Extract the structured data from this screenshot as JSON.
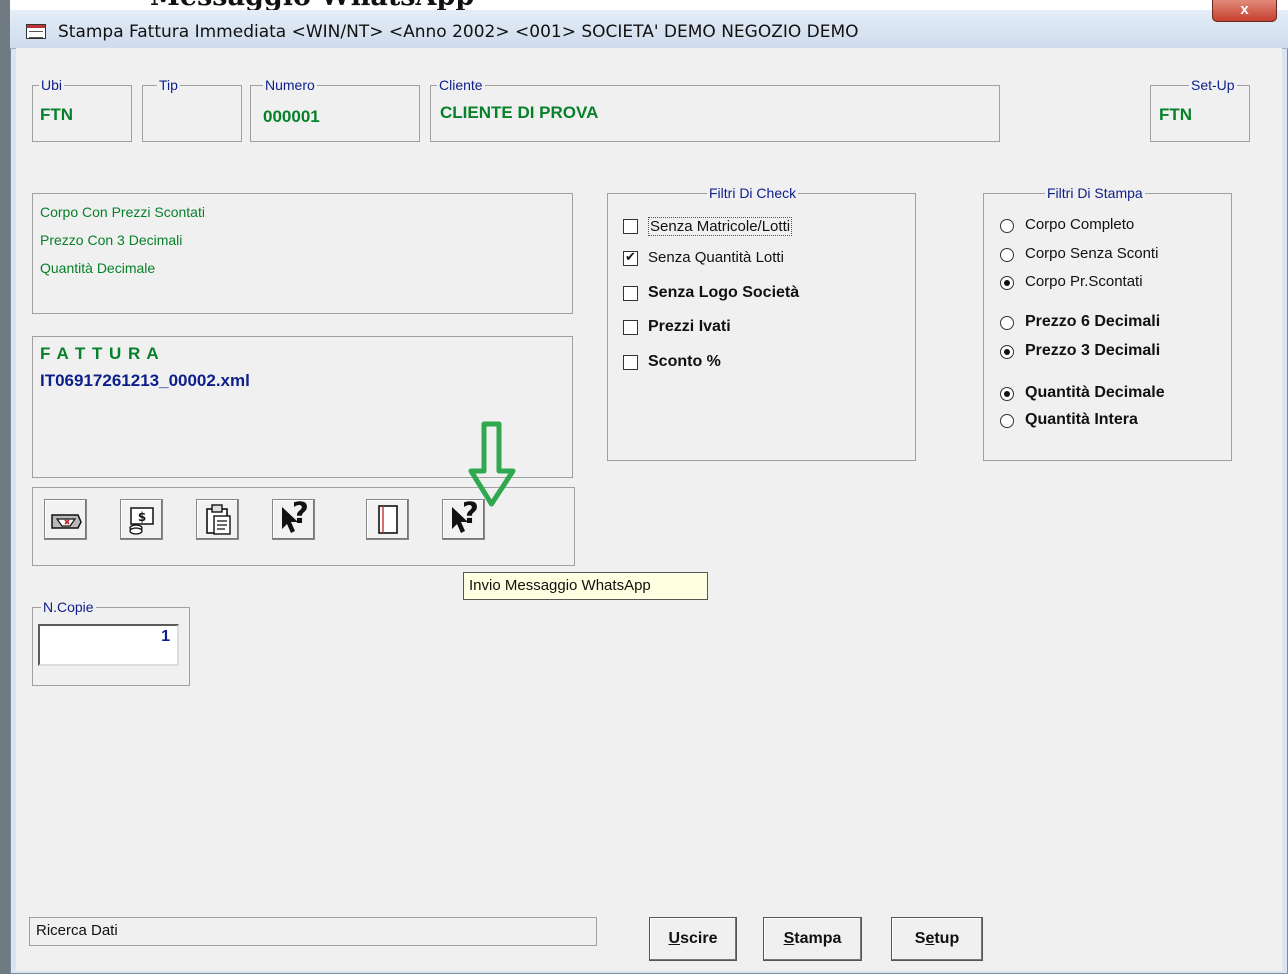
{
  "window": {
    "title": "Stampa Fattura Immediata <WIN/NT> <Anno 2002> <001> SOCIETA' DEMO NEGOZIO DEMO",
    "close_label": "x",
    "cut_heading": "Messaggio WhatsApp"
  },
  "header": {
    "ubi": {
      "label": "Ubi",
      "value": "FTN"
    },
    "tip": {
      "label": "Tip",
      "value": ""
    },
    "numero": {
      "label": "Numero",
      "value": "000001"
    },
    "cliente": {
      "label": "Cliente",
      "value": "CLIENTE DI PROVA"
    },
    "setup": {
      "label": "Set-Up",
      "value": "FTN"
    }
  },
  "info_lines": [
    "Corpo Con Prezzi Scontati",
    "Prezzo Con 3 Decimali",
    "Quantità Decimale"
  ],
  "document": {
    "type": "F A T T U R A",
    "filename": "IT06917261213_00002.xml"
  },
  "check_filters": {
    "title": "Filtri Di Check",
    "items": [
      {
        "label": "Senza Matricole/Lotti",
        "checked": false
      },
      {
        "label": "Senza Quantità Lotti",
        "checked": true
      },
      {
        "label": "Senza Logo Società",
        "checked": false
      },
      {
        "label": "Prezzi Ivati",
        "checked": false
      },
      {
        "label": "Sconto %",
        "checked": false
      }
    ]
  },
  "print_filters": {
    "title": "Filtri Di Stampa",
    "groups": [
      [
        {
          "label": "Corpo Completo",
          "selected": false
        },
        {
          "label": "Corpo Senza Sconti",
          "selected": false
        },
        {
          "label": "Corpo Pr.Scontati",
          "selected": true
        }
      ],
      [
        {
          "label": "Prezzo 6 Decimali",
          "selected": false
        },
        {
          "label": "Prezzo 3 Decimali",
          "selected": true
        }
      ],
      [
        {
          "label": "Quantità Decimale",
          "selected": true
        },
        {
          "label": "Quantità Intera",
          "selected": false
        }
      ]
    ]
  },
  "toolbar": {
    "icons": [
      "printer-icon",
      "money-icon",
      "clipboard-icon",
      "help-pointer-icon",
      "page-icon",
      "whatsapp-help-icon"
    ],
    "help_glyph": "?"
  },
  "tooltip": "Invio Messaggio WhatsApp",
  "copies": {
    "label": "N.Copie",
    "value": "1"
  },
  "status": "Ricerca Dati",
  "buttons": {
    "exit": {
      "mnemonic": "U",
      "rest": "scire"
    },
    "print": {
      "mnemonic": "S",
      "rest": "tampa"
    },
    "setup": {
      "first": "S",
      "mnemonic": "e",
      "rest": "tup"
    }
  },
  "colors": {
    "accent_green": "#06812a",
    "label_navy": "#0c1f8a",
    "arrow_green": "#2fa84f",
    "tooltip_bg": "#ffffe1"
  }
}
